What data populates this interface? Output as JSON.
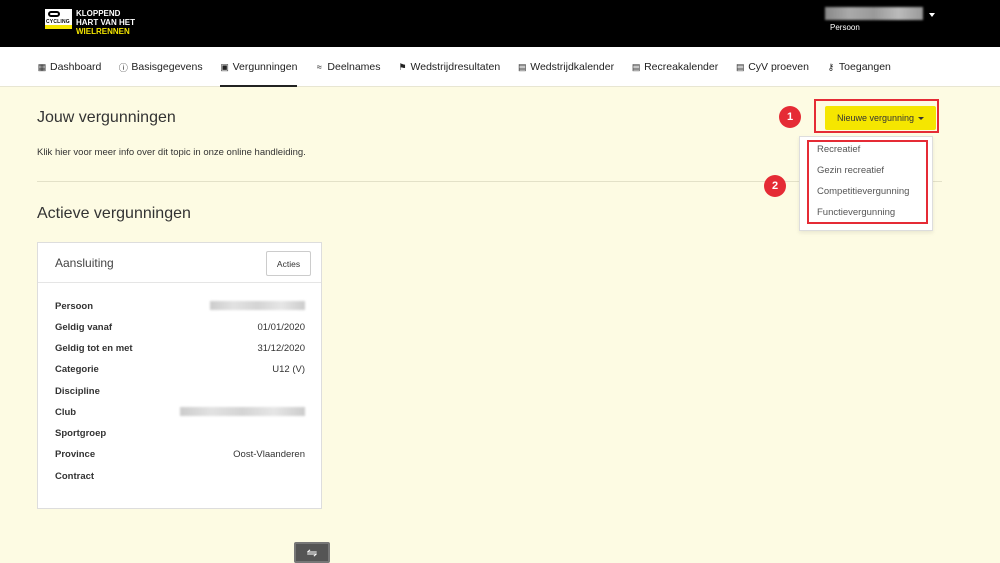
{
  "brand": {
    "line1": "KLOPPEND",
    "line2": "HART VAN HET",
    "line3": "WIELRENNEN",
    "badge": "CYCLING"
  },
  "user": {
    "role": "Persoon"
  },
  "nav": [
    {
      "label": "Dashboard",
      "icon": "grid-icon"
    },
    {
      "label": "Basisgegevens",
      "icon": "info-icon"
    },
    {
      "label": "Vergunningen",
      "icon": "license-icon",
      "active": true
    },
    {
      "label": "Deelnames",
      "icon": "layers-icon"
    },
    {
      "label": "Wedstrijdresultaten",
      "icon": "flag-icon"
    },
    {
      "label": "Wedstrijdkalender",
      "icon": "calendar-icon"
    },
    {
      "label": "Recreakalender",
      "icon": "calendar-icon"
    },
    {
      "label": "CyV proeven",
      "icon": "calendar-icon"
    },
    {
      "label": "Toegangen",
      "icon": "key-icon"
    }
  ],
  "page": {
    "title": "Jouw vergunningen",
    "help": "Klik hier voor meer info over dit topic in onze online handleiding.",
    "section_title": "Actieve vergunningen"
  },
  "new_license": {
    "label": "Nieuwe vergunning",
    "options": [
      "Recreatief",
      "Gezin recreatief",
      "Competitievergunning",
      "Functievergunning"
    ]
  },
  "markers": [
    "1",
    "2"
  ],
  "card": {
    "title": "Aansluiting",
    "actions_label": "Acties",
    "rows": [
      {
        "label": "Persoon",
        "value": ""
      },
      {
        "label": "Geldig vanaf",
        "value": "01/01/2020"
      },
      {
        "label": "Geldig tot en met",
        "value": "31/12/2020"
      },
      {
        "label": "Categorie",
        "value": "U12 (V)"
      },
      {
        "label": "Discipline",
        "value": ""
      },
      {
        "label": "Club",
        "value": ""
      },
      {
        "label": "Sportgroep",
        "value": ""
      },
      {
        "label": "Province",
        "value": "Oost-Vlaanderen"
      },
      {
        "label": "Contract",
        "value": ""
      }
    ]
  },
  "colors": {
    "accent": "#f5e600",
    "highlight": "#e52b35",
    "background": "#fdfbe3"
  }
}
